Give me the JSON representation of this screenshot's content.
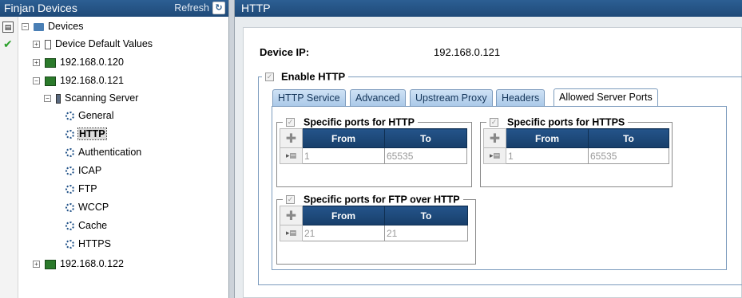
{
  "left_panel": {
    "title": "Finjan Devices",
    "refresh_label": "Refresh",
    "tree": {
      "root": "Devices",
      "default_values": "Device Default Values",
      "device_120": "192.168.0.120",
      "device_121": "192.168.0.121",
      "scanning_server": "Scanning Server",
      "items": [
        "General",
        "HTTP",
        "Authentication",
        "ICAP",
        "FTP",
        "WCCP",
        "Cache",
        "HTTPS"
      ],
      "selected_item": "HTTP",
      "device_122": "192.168.0.122"
    }
  },
  "right_panel": {
    "title": "HTTP",
    "device_ip_label": "Device IP:",
    "device_ip_value": "192.168.0.121",
    "enable_http_label": "Enable HTTP",
    "enable_http_checked": true,
    "tabs": [
      "HTTP Service",
      "Advanced",
      "Upstream Proxy",
      "Headers",
      "Allowed Server Ports"
    ],
    "active_tab": "Allowed Server Ports",
    "groups": {
      "http": {
        "label": "Specific ports for HTTP",
        "checked": true,
        "columns": [
          "From",
          "To"
        ],
        "rows": [
          [
            "1",
            "65535"
          ]
        ]
      },
      "https": {
        "label": "Specific ports for HTTPS",
        "checked": true,
        "columns": [
          "From",
          "To"
        ],
        "rows": [
          [
            "1",
            "65535"
          ]
        ]
      },
      "ftp": {
        "label": "Specific ports for FTP over HTTP",
        "checked": true,
        "columns": [
          "From",
          "To"
        ],
        "rows": [
          [
            "21",
            "21"
          ]
        ]
      }
    }
  },
  "colors": {
    "header_blue": "#1f4a78",
    "tab_blue": "#a9c8e8",
    "table_header": "#173e6a",
    "check_green": "#2aa02a"
  }
}
